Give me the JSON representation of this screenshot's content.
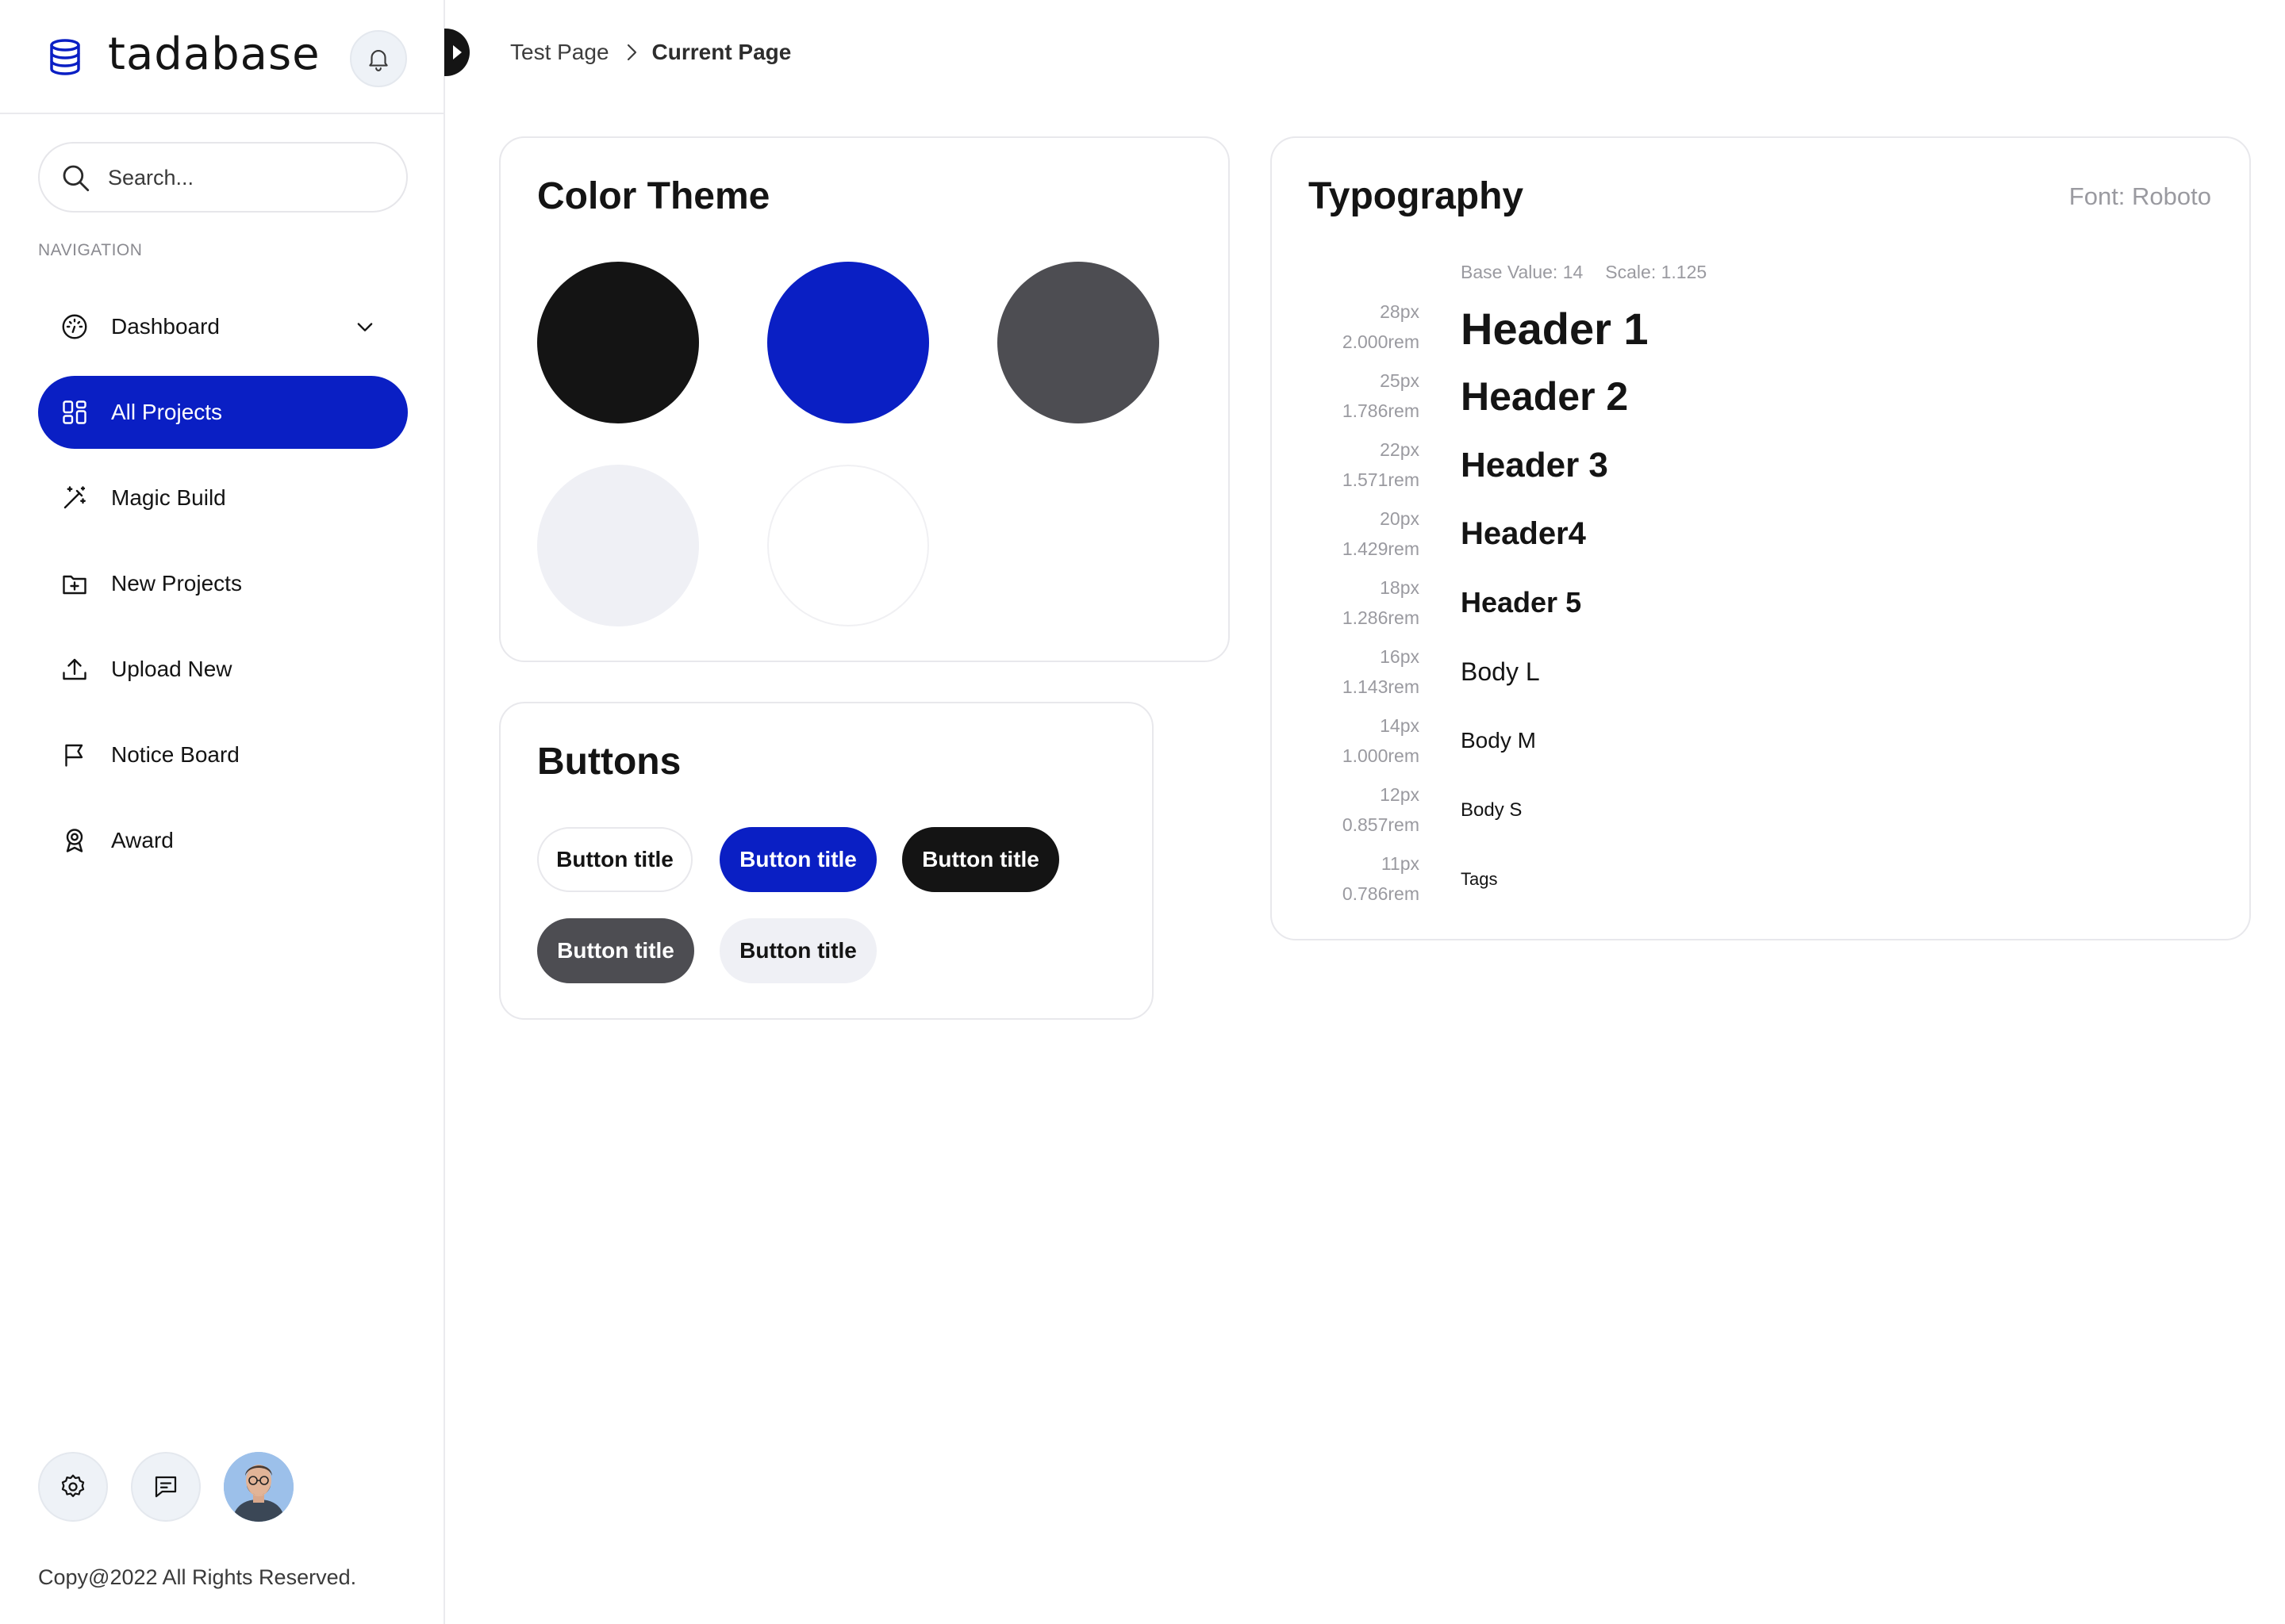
{
  "brand": {
    "name": "tadabase"
  },
  "search": {
    "placeholder": "Search..."
  },
  "navigation": {
    "heading": "NAVIGATION",
    "items": [
      {
        "label": "Dashboard",
        "icon": "dashboard-gauge-icon",
        "active": false,
        "expandable": true
      },
      {
        "label": "All Projects",
        "icon": "grid-icon",
        "active": true
      },
      {
        "label": "Magic Build",
        "icon": "magic-wand-icon",
        "active": false
      },
      {
        "label": "New Projects",
        "icon": "folder-plus-icon",
        "active": false
      },
      {
        "label": "Upload New",
        "icon": "upload-icon",
        "active": false
      },
      {
        "label": "Notice Board",
        "icon": "flag-icon",
        "active": false
      },
      {
        "label": "Award",
        "icon": "award-icon",
        "active": false
      }
    ]
  },
  "footer": {
    "copyright": "Copy@2022 All Rights Reserved."
  },
  "breadcrumb": {
    "parent": "Test Page",
    "current": "Current Page"
  },
  "color_theme": {
    "title": "Color Theme",
    "swatches": [
      "#141414",
      "#0a1fc4",
      "#4d4d52",
      "#eff0f5",
      "#ffffff"
    ]
  },
  "buttons": {
    "title": "Buttons",
    "items": [
      {
        "label": "Button title",
        "variant": "outline",
        "bg": "#ffffff",
        "fg": "#141414"
      },
      {
        "label": "Button title",
        "variant": "primary",
        "bg": "#0a1fc4",
        "fg": "#ffffff"
      },
      {
        "label": "Button title",
        "variant": "dark",
        "bg": "#141414",
        "fg": "#ffffff"
      },
      {
        "label": "Button title",
        "variant": "gray",
        "bg": "#4d4d52",
        "fg": "#ffffff"
      },
      {
        "label": "Button title",
        "variant": "light",
        "bg": "#eff0f5",
        "fg": "#141414"
      }
    ]
  },
  "typography": {
    "title": "Typography",
    "font": "Font: Roboto",
    "base_value": "Base Value: 14",
    "scale": "Scale: 1.125",
    "rows": [
      {
        "px": "28px",
        "rem": "2.000rem",
        "label": "Header 1"
      },
      {
        "px": "25px",
        "rem": "1.786rem",
        "label": "Header 2"
      },
      {
        "px": "22px",
        "rem": "1.571rem",
        "label": "Header 3"
      },
      {
        "px": "20px",
        "rem": "1.429rem",
        "label": "Header4"
      },
      {
        "px": "18px",
        "rem": "1.286rem",
        "label": "Header 5"
      },
      {
        "px": "16px",
        "rem": "1.143rem",
        "label": "Body L"
      },
      {
        "px": "14px",
        "rem": "1.000rem",
        "label": "Body M"
      },
      {
        "px": "12px",
        "rem": "0.857rem",
        "label": "Body S"
      },
      {
        "px": "11px",
        "rem": "0.786rem",
        "label": "Tags"
      }
    ]
  },
  "colors": {
    "accent": "#0a1fc4",
    "text": "#141414",
    "muted": "#9a9aa0",
    "border": "#e8e8ec"
  }
}
